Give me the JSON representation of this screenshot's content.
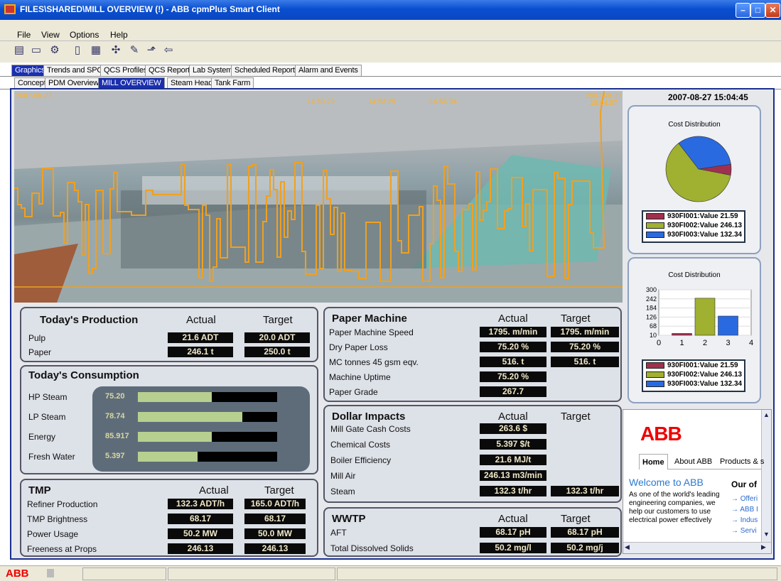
{
  "window": {
    "title": "FILES\\SHARED\\MILL OVERVIEW (!) - ABB cpmPlus Smart Client"
  },
  "menu": [
    "File",
    "View",
    "Options",
    "Help"
  ],
  "tabs_main": [
    "Graphics",
    "Trends and SPC",
    "QCS Profiles",
    "QCS Reports",
    "Lab System",
    "Scheduled Reports",
    "Alarm and Events"
  ],
  "tabs_sub": [
    "Concept",
    "PDM Overview",
    "MILL OVERVIEW",
    "Steam Headers",
    "Tank Farm"
  ],
  "trend": {
    "times": [
      "14:50:29",
      "14:53:29",
      "14:56:34"
    ],
    "start": "2007-08-27",
    "end_date": "2007-08-27",
    "end_time": "15:04:57",
    "color": "#f0a020"
  },
  "clock": "2007-08-27 15:04:45",
  "production": {
    "title": "Today's Production",
    "actual_hdr": "Actual",
    "target_hdr": "Target",
    "rows": [
      {
        "label": "Pulp",
        "actual": "21.6 ADT",
        "target": "20.0 ADT"
      },
      {
        "label": "Paper",
        "actual": "246.1 t",
        "target": "250.0 t"
      }
    ]
  },
  "consumption": {
    "title": "Today's Consumption",
    "rows": [
      {
        "label": "HP Steam",
        "value": "75.20",
        "fill": 0.53
      },
      {
        "label": "LP Steam",
        "value": "78.74",
        "fill": 0.75
      },
      {
        "label": "Energy",
        "value": "85.917",
        "fill": 0.53
      },
      {
        "label": "Fresh Water",
        "value": "5.397",
        "fill": 0.43
      }
    ]
  },
  "tmp": {
    "title": "TMP",
    "actual_hdr": "Actual",
    "target_hdr": "Target",
    "rows": [
      {
        "label": "Refiner Production",
        "actual": "132.3 ADT/h",
        "target": "165.0 ADT/h"
      },
      {
        "label": "TMP Brightness",
        "actual": "68.17",
        "target": "68.17"
      },
      {
        "label": "Power Usage",
        "actual": "50.2 MW",
        "target": "50.0 MW"
      },
      {
        "label": "Freeness at Props",
        "actual": "246.13",
        "target": "246.13"
      }
    ]
  },
  "paper_machine": {
    "title": "Paper Machine",
    "actual_hdr": "Actual",
    "target_hdr": "Target",
    "rows": [
      {
        "label": "Paper Machine Speed",
        "actual": "1795. m/min",
        "target": "1795. m/min"
      },
      {
        "label": "Dry Paper Loss",
        "actual": "75.20 %",
        "target": "75.20 %"
      },
      {
        "label": "MC tonnes 45 gsm eqv.",
        "actual": "516. t",
        "target": "516. t"
      },
      {
        "label": "Machine Uptime",
        "actual": "75.20 %",
        "target": ""
      },
      {
        "label": "Paper Grade",
        "actual": "267.7",
        "target": ""
      }
    ]
  },
  "dollar": {
    "title": "Dollar Impacts",
    "actual_hdr": "Actual",
    "target_hdr": "Target",
    "rows": [
      {
        "label": "Mill Gate Cash Costs",
        "actual": "263.6 $",
        "target": ""
      },
      {
        "label": "Chemical Costs",
        "actual": "5.397 $/t",
        "target": ""
      },
      {
        "label": "Boiler Efficiency",
        "actual": "21.6 MJ/t",
        "target": ""
      },
      {
        "label": "Mill Air",
        "actual": "246.13 m3/min",
        "target": ""
      },
      {
        "label": "Steam",
        "actual": "132.3 t/hr",
        "target": "132.3 t/hr"
      }
    ]
  },
  "wwtp": {
    "title": "WWTP",
    "actual_hdr": "Actual",
    "target_hdr": "Target",
    "rows": [
      {
        "label": "AFT",
        "actual": "68.17 pH",
        "target": "68.17 pH"
      },
      {
        "label": "Total Dissolved Solids",
        "actual": "50.2 mg/l",
        "target": "50.2 mg/j"
      }
    ]
  },
  "cost_pie": {
    "title": "Cost Distribution",
    "legend": [
      "930FI001:Value 21.59",
      "930FI002:Value 246.13",
      "930FI003:Value 132.34"
    ]
  },
  "cost_bar": {
    "title": "Cost Distribution",
    "legend": [
      "930FI001:Value 21.59",
      "930FI002:Value 246.13",
      "930FI003:Value 132.34"
    ]
  },
  "chart_data": [
    {
      "type": "pie",
      "title": "Cost Distribution",
      "series": [
        {
          "name": "930FI001:Value",
          "value": 21.59,
          "color": "#a03050"
        },
        {
          "name": "930FI002:Value",
          "value": 246.13,
          "color": "#a0b030"
        },
        {
          "name": "930FI003:Value",
          "value": 132.34,
          "color": "#2a6ae0"
        }
      ]
    },
    {
      "type": "bar",
      "title": "Cost Distribution",
      "x": [
        1,
        2,
        3
      ],
      "values": [
        21.59,
        246.13,
        132.34
      ],
      "colors": [
        "#a03050",
        "#a0b030",
        "#2a6ae0"
      ],
      "xticks": [
        "0",
        "1",
        "2",
        "3",
        "4"
      ],
      "yticks": [
        "300",
        "242",
        "184",
        "126",
        "68",
        "10"
      ],
      "xlim": [
        0,
        4
      ],
      "ylim": [
        10,
        300
      ]
    }
  ],
  "browser": {
    "tabs": [
      "Home",
      "About ABB",
      "Products & s"
    ],
    "welcome": "Welcome to ABB",
    "body": "As one of the world's leading engineering companies, we help our customers to use electrical power effectively",
    "side_title": "Our of",
    "links": [
      "Offeri",
      "ABB I",
      "Indus",
      "Servi"
    ],
    "logo": "ABB"
  },
  "status": {
    "logo": "ABB"
  }
}
